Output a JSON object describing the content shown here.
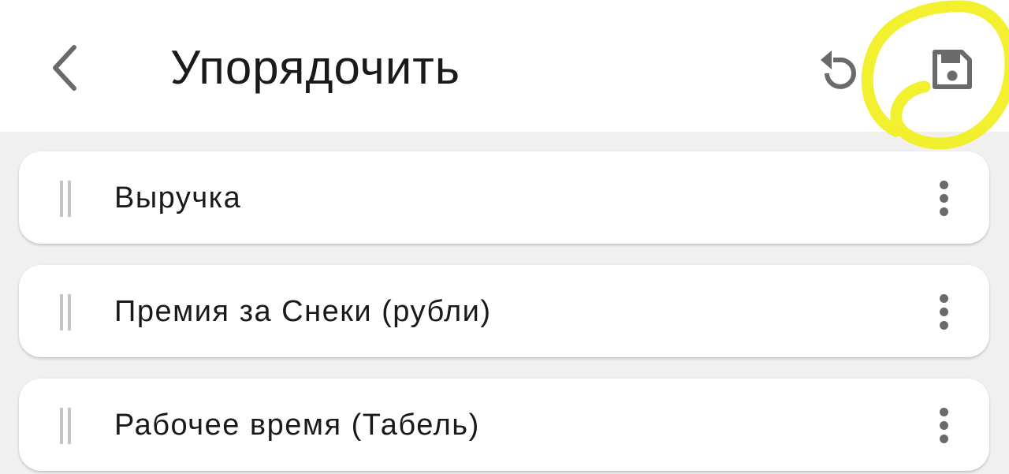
{
  "header": {
    "title": "Упорядочить",
    "back_icon": "chevron-left-icon",
    "reset_icon": "reset-icon",
    "save_icon": "save-icon",
    "highlight_color": "#f2ee1a"
  },
  "items": [
    {
      "label": "Выручка"
    },
    {
      "label": "Премия за Снеки (рубли)"
    },
    {
      "label": "Рабочее время (Табель)"
    }
  ],
  "colors": {
    "background": "#f0f0f0",
    "surface": "#ffffff",
    "text": "#1a1a1a",
    "icon": "#6a6a6a",
    "drag_handle": "#c4c4c4"
  }
}
